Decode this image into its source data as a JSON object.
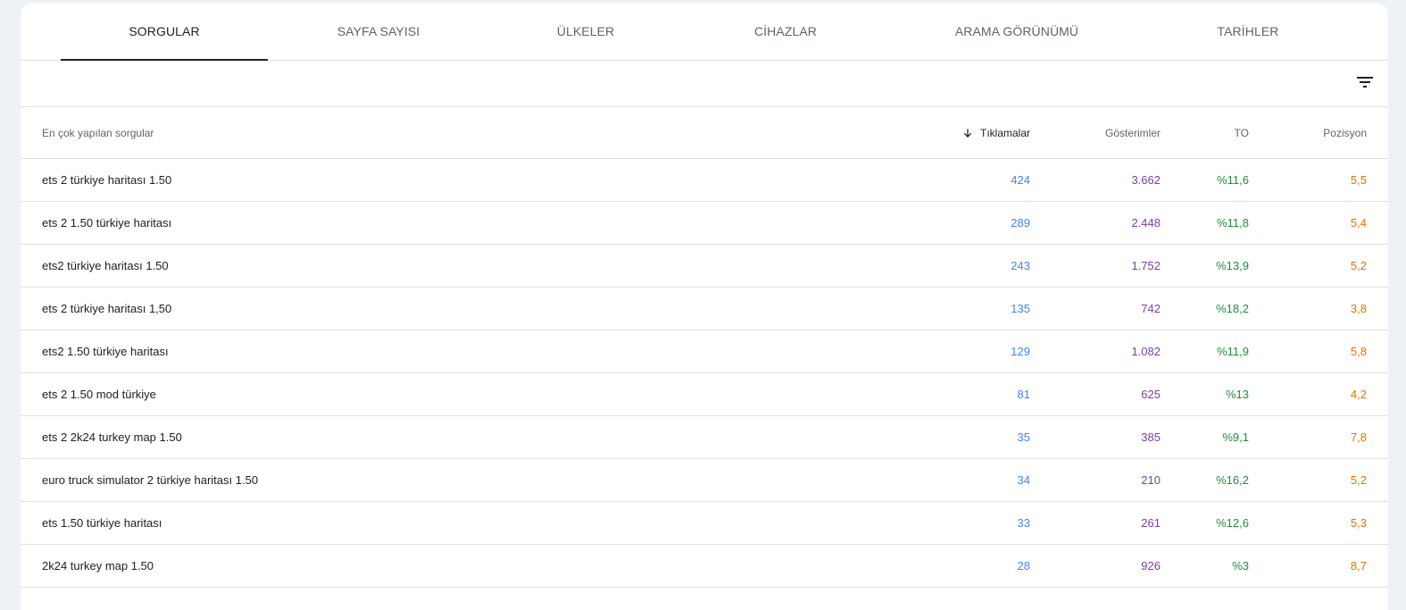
{
  "tabs": [
    {
      "label": "SORGULAR",
      "active": true
    },
    {
      "label": "SAYFA SAYISI",
      "active": false
    },
    {
      "label": "ÜLKELER",
      "active": false
    },
    {
      "label": "CİHAZLAR",
      "active": false
    },
    {
      "label": "ARAMA GÖRÜNÜMÜ",
      "active": false
    },
    {
      "label": "TARİHLER",
      "active": false
    }
  ],
  "toolbar": {
    "filter_icon": "filter-list-icon"
  },
  "table": {
    "headers": {
      "query": "En çok yapılan sorgular",
      "clicks": "Tıklamalar",
      "impressions": "Gösterimler",
      "ctr": "TO",
      "position": "Pozisyon"
    },
    "sort_icon": "arrow-down-icon",
    "colors": {
      "clicks": "#4285f4",
      "impressions": "#7b3fa0",
      "ctr": "#1e8e3e",
      "position": "#e37400"
    },
    "rows": [
      {
        "query": "ets 2 türkiye haritası 1.50",
        "clicks": "424",
        "impressions": "3.662",
        "ctr": "%11,6",
        "position": "5,5"
      },
      {
        "query": "ets 2 1.50 türkiye haritası",
        "clicks": "289",
        "impressions": "2.448",
        "ctr": "%11,8",
        "position": "5,4"
      },
      {
        "query": "ets2 türkiye haritası 1.50",
        "clicks": "243",
        "impressions": "1.752",
        "ctr": "%13,9",
        "position": "5,2"
      },
      {
        "query": "ets 2 türkiye haritası 1,50",
        "clicks": "135",
        "impressions": "742",
        "ctr": "%18,2",
        "position": "3,8"
      },
      {
        "query": "ets2 1.50 türkiye haritası",
        "clicks": "129",
        "impressions": "1.082",
        "ctr": "%11,9",
        "position": "5,8"
      },
      {
        "query": "ets 2 1.50 mod türkiye",
        "clicks": "81",
        "impressions": "625",
        "ctr": "%13",
        "position": "4,2"
      },
      {
        "query": "ets 2 2k24 turkey map 1.50",
        "clicks": "35",
        "impressions": "385",
        "ctr": "%9,1",
        "position": "7,8"
      },
      {
        "query": "euro truck simulator 2 türkiye haritası 1.50",
        "clicks": "34",
        "impressions": "210",
        "ctr": "%16,2",
        "position": "5,2"
      },
      {
        "query": "ets 1.50 türkiye haritası",
        "clicks": "33",
        "impressions": "261",
        "ctr": "%12,6",
        "position": "5,3"
      },
      {
        "query": "2k24 turkey map 1.50",
        "clicks": "28",
        "impressions": "926",
        "ctr": "%3",
        "position": "8,7"
      }
    ]
  }
}
